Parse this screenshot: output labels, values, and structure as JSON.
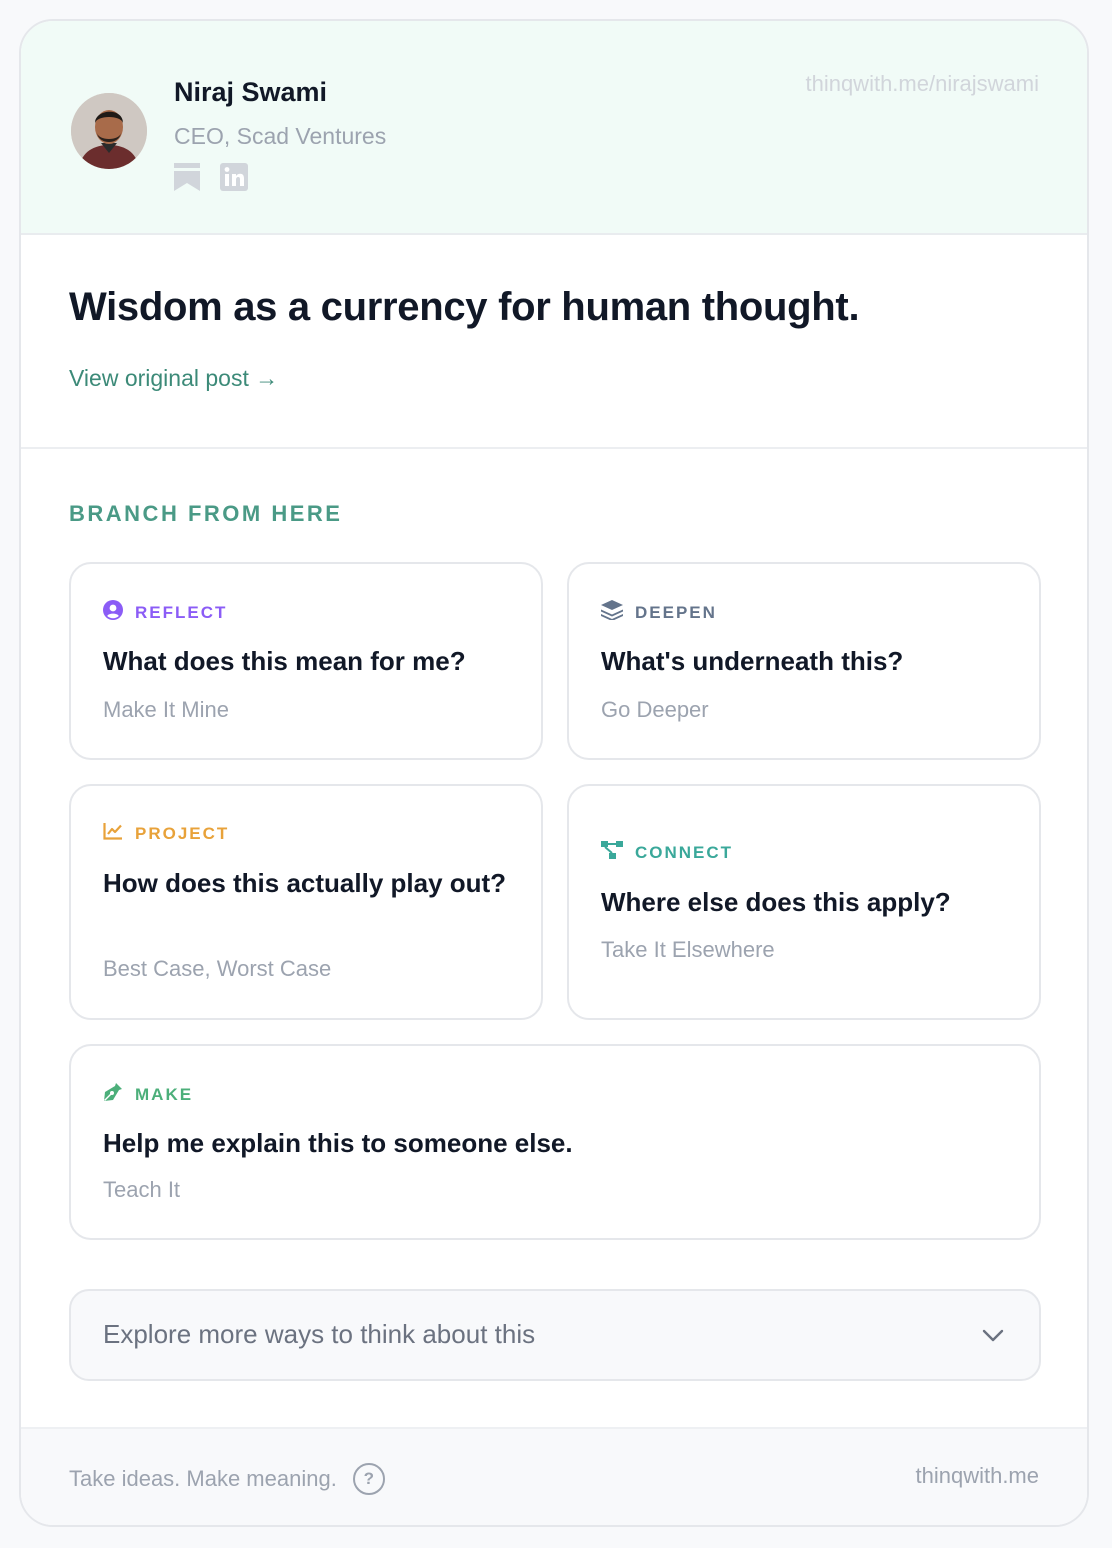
{
  "author": {
    "name": "Niraj Swami",
    "title": "CEO, Scad Ventures",
    "profile_url_text": "thinqwith.me/nirajswami",
    "social": [
      "bookmark-icon",
      "linkedin-icon"
    ]
  },
  "post": {
    "title": "Wisdom as a currency for human thought.",
    "view_link": "View original post →"
  },
  "branch": {
    "heading": "BRANCH FROM HERE",
    "options": [
      {
        "tag": "REFLECT",
        "question": "What does this mean for me?",
        "subtitle": "Make It Mine",
        "color": "#8b5cf6",
        "icon": "user-circle-icon"
      },
      {
        "tag": "DEEPEN",
        "question": "What's underneath this?",
        "subtitle": "Go Deeper",
        "color": "#64748b",
        "icon": "layers-icon"
      },
      {
        "tag": "PROJECT",
        "question": "How does this actually play out?",
        "subtitle": "Best Case, Worst Case",
        "color": "#e8a23a",
        "icon": "line-chart-icon"
      },
      {
        "tag": "CONNECT",
        "question": "Where else does this apply?",
        "subtitle": "Take It Elsewhere",
        "color": "#3aa89a",
        "icon": "network-icon"
      },
      {
        "tag": "MAKE",
        "question": "Help me explain this to someone else.",
        "subtitle": "Teach It",
        "color": "#4caf7a",
        "icon": "pen-nib-icon"
      }
    ]
  },
  "explore": {
    "label": "Explore more ways to think about this"
  },
  "footer": {
    "tagline": "Take ideas. Make meaning.",
    "brand": "thinqwith.me"
  }
}
